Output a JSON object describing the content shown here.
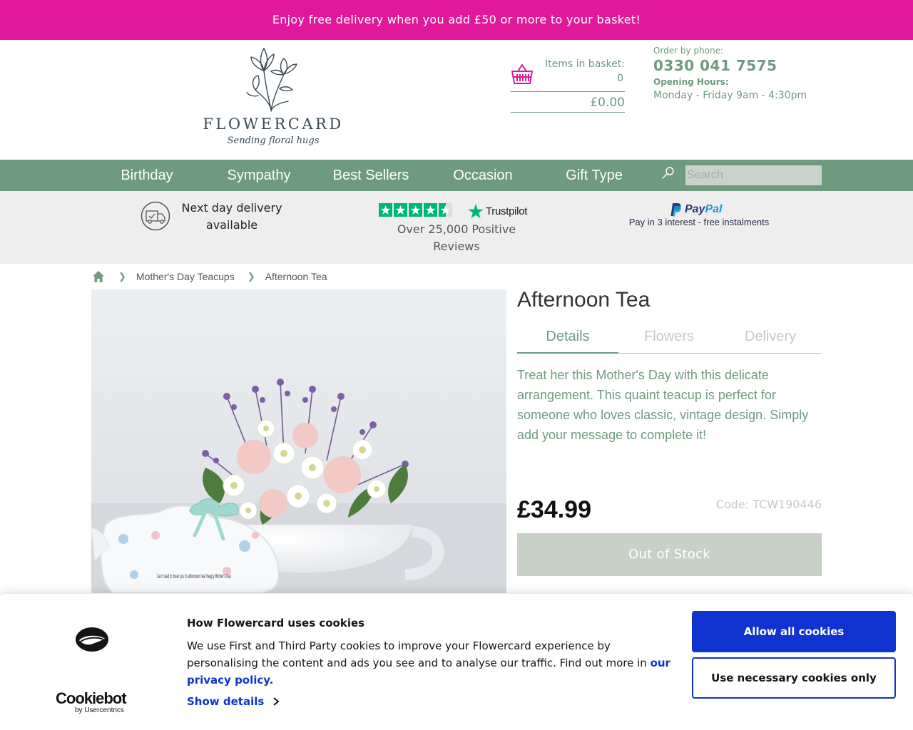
{
  "promo": {
    "text": "Enjoy free delivery when you add £50 or more to your basket!"
  },
  "logo": {
    "name": "FLOWERCARD",
    "tagline": "Sending floral hugs"
  },
  "basket": {
    "label": "Items in basket:",
    "count": "0",
    "total": "£0.00",
    "icon": "basket-icon"
  },
  "contact": {
    "order_label": "Order by phone:",
    "phone": "0330 041 7575",
    "hours_label": "Opening Hours:",
    "hours": "Monday - Friday 9am - 4:30pm"
  },
  "nav": {
    "items": [
      "Birthday",
      "Sympathy",
      "Best Sellers",
      "Occasion",
      "Gift Type"
    ],
    "search_placeholder": "Search"
  },
  "usp": {
    "delivery": "Next day delivery available",
    "trustpilot_brand": "Trustpilot",
    "trustpilot_text": "Over 25,000 Positive Reviews",
    "paypal_brand": "PayPal",
    "paypal_text": "Pay in 3 interest - free instalments"
  },
  "breadcrumb": {
    "items": [
      "Mother's Day Teacups",
      "Afternoon Tea"
    ]
  },
  "product": {
    "title": "Afternoon Tea",
    "tabs": [
      "Details",
      "Flowers",
      "Delivery"
    ],
    "active_tab": "Details",
    "description": "Treat her this Mother's Day with this delicate arrangement. This quaint teacup is perfect for someone who loves classic, vintage design. Simply add your message to complete it!",
    "price": "£34.99",
    "code": "Code: TCW190446",
    "stock_button": "Out of Stock",
    "card_message": "Can't wait to treat you to afternoon tea! Happy Mother's Day"
  },
  "cookie": {
    "brand": "Cookiebot",
    "brand_sub": "by Usercentrics",
    "title": "How Flowercard uses cookies",
    "text": "We use First and Third Party cookies to improve your Flowercard experience by personalising the content and ads you see and to analyse our traffic. Find out more in",
    "link": "our privacy policy.",
    "show_details": "Show details",
    "allow_all": "Allow all cookies",
    "necessary_only": "Use necessary cookies only"
  },
  "colors": {
    "promo_pink": "#e0199a",
    "brand_green": "#6e9b7f",
    "cookie_blue": "#1032cf",
    "trustpilot_green": "#00b67a",
    "out_of_stock": "#c7d1c8"
  }
}
